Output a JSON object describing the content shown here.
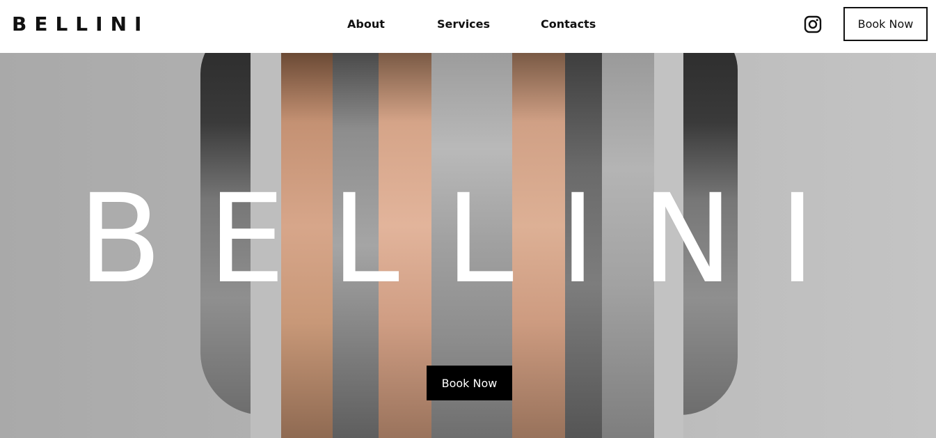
{
  "brand": {
    "logo_text": "BELLINI"
  },
  "nav": {
    "items": [
      {
        "label": "About"
      },
      {
        "label": "Services"
      },
      {
        "label": "Contacts"
      }
    ]
  },
  "header": {
    "social_icon": "instagram-icon",
    "book_button_label": "Book Now"
  },
  "hero": {
    "title": "BELLINI",
    "cta_label": "Book Now",
    "image_description_icon": "collage-face-strips"
  },
  "colors": {
    "text": "#111111",
    "hero_title": "#ffffff",
    "cta_bg": "#000000",
    "cta_text": "#ffffff",
    "background": "#ffffff"
  }
}
